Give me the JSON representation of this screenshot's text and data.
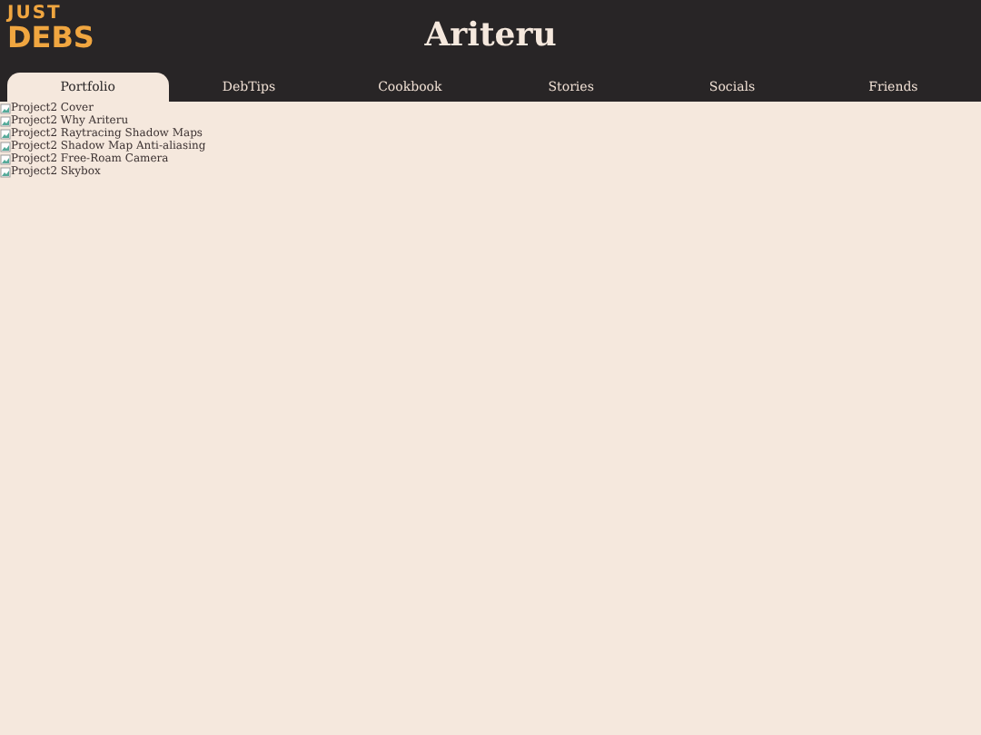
{
  "logo": {
    "lines": [
      "JUST",
      "DEBS"
    ]
  },
  "title": "Ariteru",
  "tabs": [
    {
      "label": "Portfolio",
      "selected": true
    },
    {
      "label": "DebTips",
      "selected": false
    },
    {
      "label": "Cookbook",
      "selected": false
    },
    {
      "label": "Stories",
      "selected": false
    },
    {
      "label": "Socials",
      "selected": false
    },
    {
      "label": "Friends",
      "selected": false
    }
  ],
  "images": [
    {
      "alt": "Project2 Cover"
    },
    {
      "alt": "Project2 Why Ariteru"
    },
    {
      "alt": "Project2 Raytracing Shadow Maps"
    },
    {
      "alt": "Project2 Shadow Map Anti-aliasing"
    },
    {
      "alt": "Project2 Free-Roam Camera"
    },
    {
      "alt": "Project2 Skybox"
    }
  ]
}
